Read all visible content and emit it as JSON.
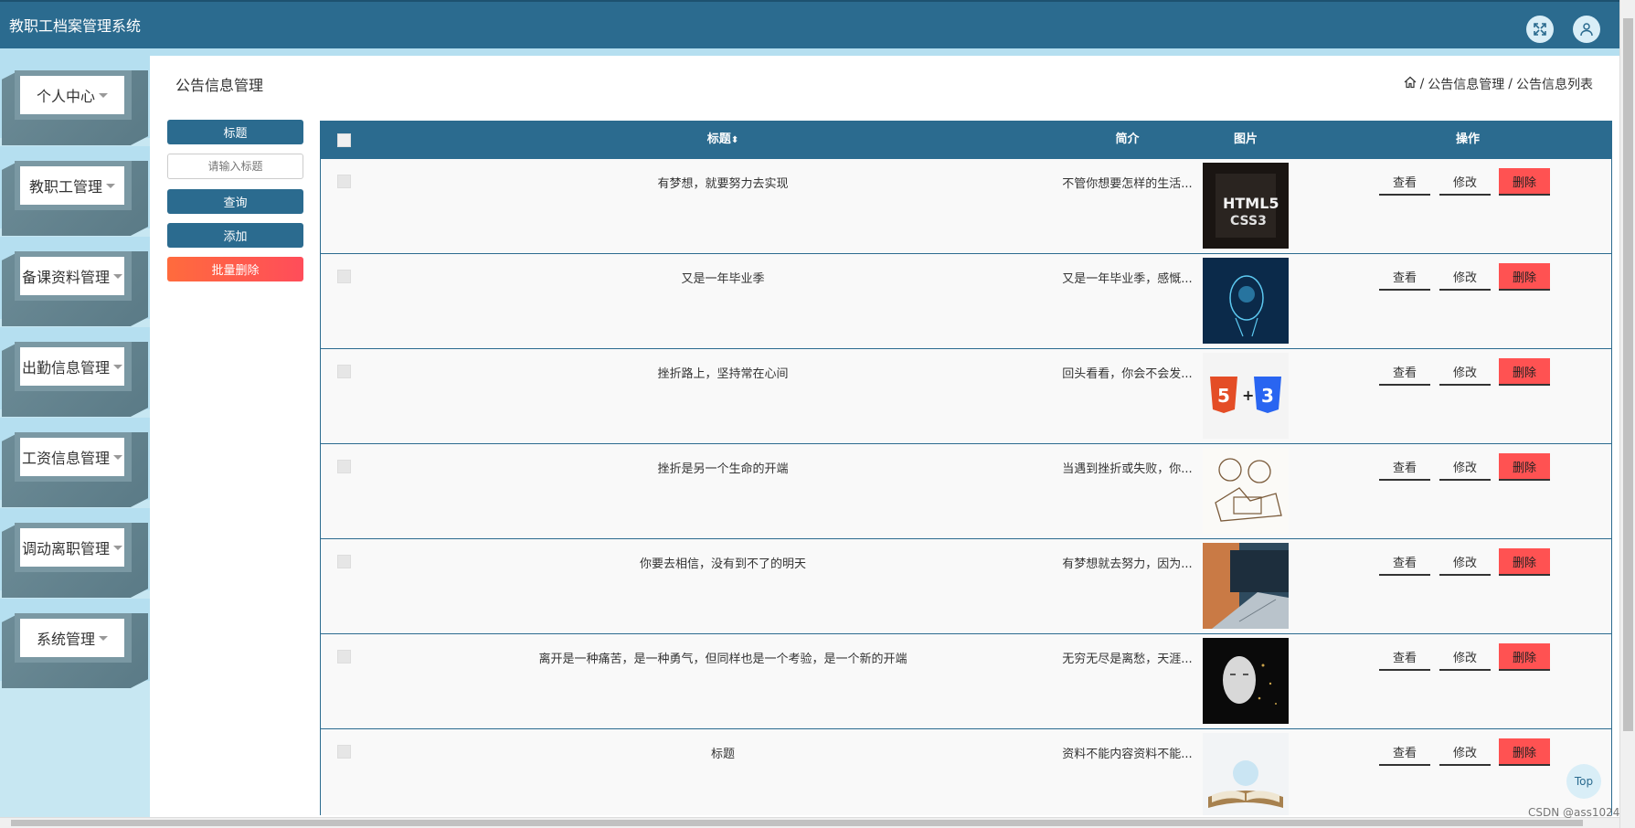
{
  "app": {
    "title": "教职工档案管理系统"
  },
  "header": {
    "expand_icon": "expand-icon",
    "user_icon": "user-icon"
  },
  "sidebar": {
    "items": [
      {
        "label": "个人中心"
      },
      {
        "label": "教职工管理"
      },
      {
        "label": "备课资料管理"
      },
      {
        "label": "出勤信息管理"
      },
      {
        "label": "工资信息管理"
      },
      {
        "label": "调动离职管理"
      },
      {
        "label": "系统管理"
      }
    ]
  },
  "page": {
    "title": "公告信息管理",
    "breadcrumb": {
      "sep": "/",
      "level1": "公告信息管理",
      "level2": "公告信息列表"
    }
  },
  "search": {
    "field_label": "标题",
    "placeholder": "请输入标题",
    "query_label": "查询",
    "add_label": "添加",
    "batch_delete_label": "批量删除"
  },
  "table": {
    "columns": {
      "title": "标题",
      "intro": "简介",
      "image": "图片",
      "actions": "操作"
    },
    "actions": {
      "view": "查看",
      "edit": "修改",
      "delete": "删除"
    },
    "rows": [
      {
        "title": "有梦想，就要努力去实现",
        "intro": "不管你想要怎样的生活...",
        "image": "html5-css3-book"
      },
      {
        "title": "又是一年毕业季",
        "intro": "又是一年毕业季，感慨...",
        "image": "digital-head"
      },
      {
        "title": "挫折路上，坚持常在心间",
        "intro": "回头看看，你会不会发...",
        "image": "html5-css3-logos"
      },
      {
        "title": "挫折是另一个生命的开端",
        "intro": "当遇到挫折或失败，你...",
        "image": "sketch-people"
      },
      {
        "title": "你要去相信，没有到不了的明天",
        "intro": "有梦想就去努力，因为...",
        "image": "laptop"
      },
      {
        "title": "离开是一种痛苦，是一种勇气，但同样也是一个考验，是一个新的开端",
        "intro": "无穷无尽是离愁，天涯...",
        "image": "ai-face"
      },
      {
        "title": "标题",
        "intro": "资料不能内容资料不能...",
        "image": "open-book"
      }
    ]
  },
  "footer": {
    "top_label": "Top",
    "watermark": "CSDN @ass1024"
  },
  "colors": {
    "primary": "#2b6b8f",
    "danger": "#ff5252",
    "sidebar_bg": "#b5dff0"
  }
}
